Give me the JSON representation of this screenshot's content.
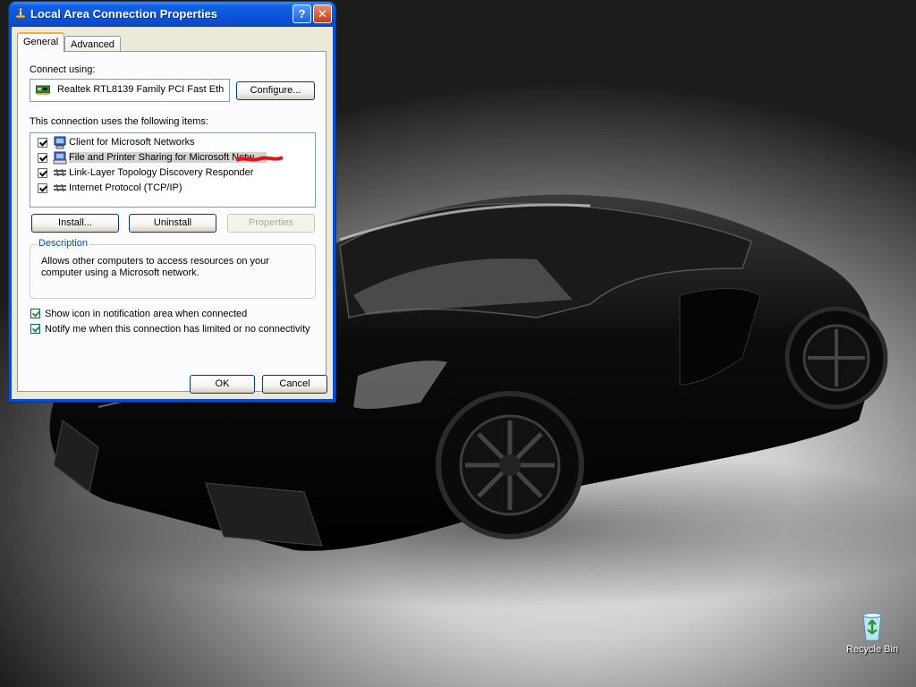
{
  "window": {
    "title": "Local Area Connection Properties",
    "help_label": "?",
    "close_label": "✕"
  },
  "tabs": [
    {
      "label": "General",
      "active": true
    },
    {
      "label": "Advanced",
      "active": false
    }
  ],
  "general": {
    "connect_using_label": "Connect using:",
    "adapter_name": "Realtek RTL8139 Family PCI Fast Eth",
    "configure_label": "Configure...",
    "items_label": "This connection uses the following items:",
    "items": [
      {
        "label": "Client for Microsoft Networks",
        "checked": true,
        "icon": "network-client-icon"
      },
      {
        "label": "File and Printer Sharing for Microsoft Netw",
        "checked": true,
        "icon": "file-printer-sharing-icon",
        "selected": true
      },
      {
        "label": "Link-Layer Topology Discovery Responder",
        "checked": true,
        "icon": "protocol-icon"
      },
      {
        "label": "Internet Protocol (TCP/IP)",
        "checked": true,
        "icon": "protocol-icon"
      }
    ],
    "install_label": "Install...",
    "uninstall_label": "Uninstall",
    "properties_label": "Properties",
    "description_title": "Description",
    "description_text": "Allows other computers to access resources on your computer using a Microsoft network.",
    "show_icon_label": "Show icon in notification area when connected",
    "notify_label": "Notify me when this connection has limited or no connectivity"
  },
  "footer": {
    "ok_label": "OK",
    "cancel_label": "Cancel"
  },
  "desktop": {
    "recycle_bin_label": "Recycle Bin"
  },
  "colors": {
    "titlebar": "#0a54d8",
    "dialog_face": "#ece9d8",
    "accent_tab": "#f7ac3a",
    "groupbox_title": "#0046d5"
  }
}
